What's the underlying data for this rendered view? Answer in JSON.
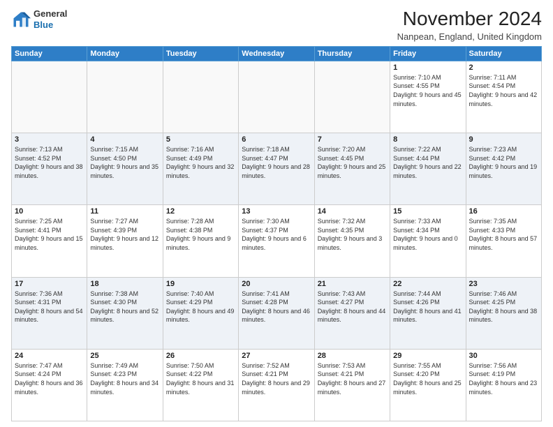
{
  "header": {
    "logo_line1": "General",
    "logo_line2": "Blue",
    "month_title": "November 2024",
    "location": "Nanpean, England, United Kingdom"
  },
  "weekdays": [
    "Sunday",
    "Monday",
    "Tuesday",
    "Wednesday",
    "Thursday",
    "Friday",
    "Saturday"
  ],
  "weeks": [
    [
      {
        "day": "",
        "info": ""
      },
      {
        "day": "",
        "info": ""
      },
      {
        "day": "",
        "info": ""
      },
      {
        "day": "",
        "info": ""
      },
      {
        "day": "",
        "info": ""
      },
      {
        "day": "1",
        "info": "Sunrise: 7:10 AM\nSunset: 4:55 PM\nDaylight: 9 hours and 45 minutes."
      },
      {
        "day": "2",
        "info": "Sunrise: 7:11 AM\nSunset: 4:54 PM\nDaylight: 9 hours and 42 minutes."
      }
    ],
    [
      {
        "day": "3",
        "info": "Sunrise: 7:13 AM\nSunset: 4:52 PM\nDaylight: 9 hours and 38 minutes."
      },
      {
        "day": "4",
        "info": "Sunrise: 7:15 AM\nSunset: 4:50 PM\nDaylight: 9 hours and 35 minutes."
      },
      {
        "day": "5",
        "info": "Sunrise: 7:16 AM\nSunset: 4:49 PM\nDaylight: 9 hours and 32 minutes."
      },
      {
        "day": "6",
        "info": "Sunrise: 7:18 AM\nSunset: 4:47 PM\nDaylight: 9 hours and 28 minutes."
      },
      {
        "day": "7",
        "info": "Sunrise: 7:20 AM\nSunset: 4:45 PM\nDaylight: 9 hours and 25 minutes."
      },
      {
        "day": "8",
        "info": "Sunrise: 7:22 AM\nSunset: 4:44 PM\nDaylight: 9 hours and 22 minutes."
      },
      {
        "day": "9",
        "info": "Sunrise: 7:23 AM\nSunset: 4:42 PM\nDaylight: 9 hours and 19 minutes."
      }
    ],
    [
      {
        "day": "10",
        "info": "Sunrise: 7:25 AM\nSunset: 4:41 PM\nDaylight: 9 hours and 15 minutes."
      },
      {
        "day": "11",
        "info": "Sunrise: 7:27 AM\nSunset: 4:39 PM\nDaylight: 9 hours and 12 minutes."
      },
      {
        "day": "12",
        "info": "Sunrise: 7:28 AM\nSunset: 4:38 PM\nDaylight: 9 hours and 9 minutes."
      },
      {
        "day": "13",
        "info": "Sunrise: 7:30 AM\nSunset: 4:37 PM\nDaylight: 9 hours and 6 minutes."
      },
      {
        "day": "14",
        "info": "Sunrise: 7:32 AM\nSunset: 4:35 PM\nDaylight: 9 hours and 3 minutes."
      },
      {
        "day": "15",
        "info": "Sunrise: 7:33 AM\nSunset: 4:34 PM\nDaylight: 9 hours and 0 minutes."
      },
      {
        "day": "16",
        "info": "Sunrise: 7:35 AM\nSunset: 4:33 PM\nDaylight: 8 hours and 57 minutes."
      }
    ],
    [
      {
        "day": "17",
        "info": "Sunrise: 7:36 AM\nSunset: 4:31 PM\nDaylight: 8 hours and 54 minutes."
      },
      {
        "day": "18",
        "info": "Sunrise: 7:38 AM\nSunset: 4:30 PM\nDaylight: 8 hours and 52 minutes."
      },
      {
        "day": "19",
        "info": "Sunrise: 7:40 AM\nSunset: 4:29 PM\nDaylight: 8 hours and 49 minutes."
      },
      {
        "day": "20",
        "info": "Sunrise: 7:41 AM\nSunset: 4:28 PM\nDaylight: 8 hours and 46 minutes."
      },
      {
        "day": "21",
        "info": "Sunrise: 7:43 AM\nSunset: 4:27 PM\nDaylight: 8 hours and 44 minutes."
      },
      {
        "day": "22",
        "info": "Sunrise: 7:44 AM\nSunset: 4:26 PM\nDaylight: 8 hours and 41 minutes."
      },
      {
        "day": "23",
        "info": "Sunrise: 7:46 AM\nSunset: 4:25 PM\nDaylight: 8 hours and 38 minutes."
      }
    ],
    [
      {
        "day": "24",
        "info": "Sunrise: 7:47 AM\nSunset: 4:24 PM\nDaylight: 8 hours and 36 minutes."
      },
      {
        "day": "25",
        "info": "Sunrise: 7:49 AM\nSunset: 4:23 PM\nDaylight: 8 hours and 34 minutes."
      },
      {
        "day": "26",
        "info": "Sunrise: 7:50 AM\nSunset: 4:22 PM\nDaylight: 8 hours and 31 minutes."
      },
      {
        "day": "27",
        "info": "Sunrise: 7:52 AM\nSunset: 4:21 PM\nDaylight: 8 hours and 29 minutes."
      },
      {
        "day": "28",
        "info": "Sunrise: 7:53 AM\nSunset: 4:21 PM\nDaylight: 8 hours and 27 minutes."
      },
      {
        "day": "29",
        "info": "Sunrise: 7:55 AM\nSunset: 4:20 PM\nDaylight: 8 hours and 25 minutes."
      },
      {
        "day": "30",
        "info": "Sunrise: 7:56 AM\nSunset: 4:19 PM\nDaylight: 8 hours and 23 minutes."
      }
    ]
  ]
}
